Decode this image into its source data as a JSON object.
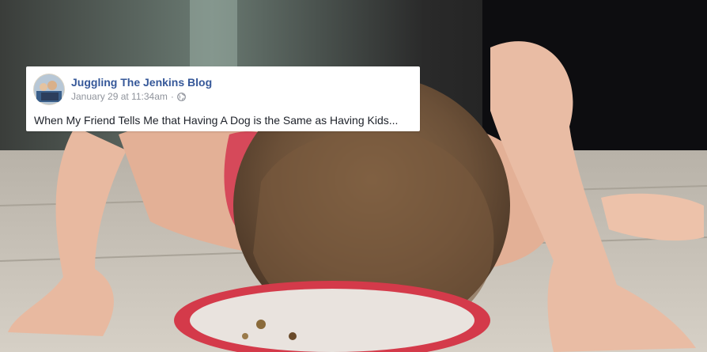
{
  "post": {
    "author": "Juggling The Jenkins Blog",
    "timestamp": "January 29 at 11:34am",
    "separator": "·",
    "privacy_icon": "globe-icon",
    "text": "When My Friend Tells Me that Having A Dog is the Same as Having Kids..."
  },
  "photo": {
    "subject": "toddler-face-down-on-floor-plate"
  },
  "colors": {
    "author_link": "#365899",
    "meta_text": "#90949c",
    "body_text": "#1d2129"
  }
}
